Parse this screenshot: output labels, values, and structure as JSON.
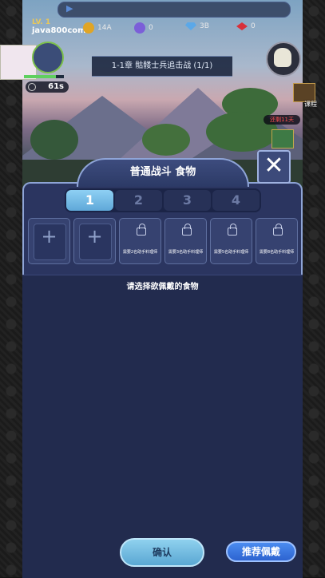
{
  "player": {
    "level": "LV. 1",
    "name": "java800com"
  },
  "currencies": [
    {
      "icon": "gold-coin-icon",
      "value": "14A",
      "color": "#e0a526"
    },
    {
      "icon": "purple-coin-icon",
      "value": "0",
      "color": "#7b5fd8"
    },
    {
      "icon": "diamond-icon",
      "value": "3B",
      "color": "#5ba8e8"
    },
    {
      "icon": "ruby-icon",
      "value": "0",
      "color": "#d8303a"
    }
  ],
  "timer": "61s",
  "xp_fraction": 0.8,
  "chapter_title": "1-1章 骷髅士兵追击战 (1/1)",
  "side": {
    "chest_label": "课程",
    "deadline_label": "还剩11天"
  },
  "panel": {
    "title": "普通战斗 食物",
    "tabs": [
      "1",
      "2",
      "3",
      "4"
    ],
    "active_tab": 0,
    "slots": [
      {
        "type": "empty"
      },
      {
        "type": "empty"
      },
      {
        "type": "locked",
        "requirement": "需要2名助手料理师"
      },
      {
        "type": "locked",
        "requirement": "需要3名助手料理师"
      },
      {
        "type": "locked",
        "requirement": "需要5名助手料理师"
      },
      {
        "type": "locked",
        "requirement": "需要8名助手料理师"
      }
    ],
    "hint": "请选择欲佩戴的食物",
    "confirm_label": "确认",
    "recommend_label": "推荐佩戴"
  }
}
